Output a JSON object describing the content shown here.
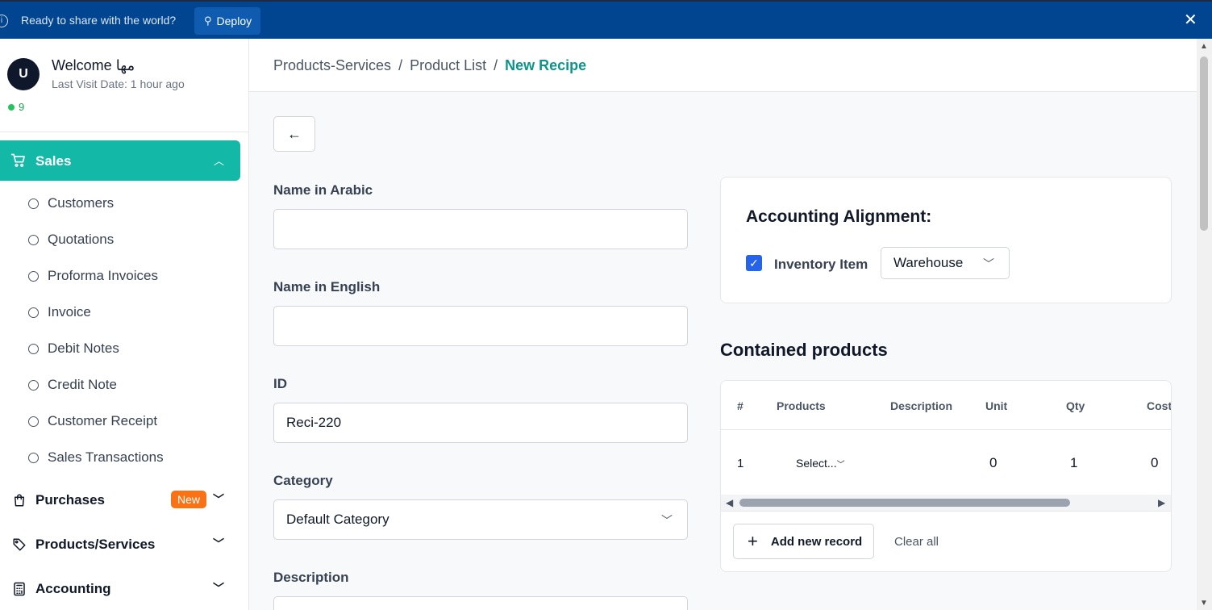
{
  "banner": {
    "message": "Ready to share with the world?",
    "deploy_label": "Deploy",
    "close_symbol": "✕"
  },
  "user": {
    "avatar_initial": "U",
    "welcome": "Welcome مها",
    "last_visit": "Last Visit Date: 1 hour ago",
    "status_count": "9"
  },
  "sidebar": {
    "sales_label": "Sales",
    "sales_items": [
      "Customers",
      "Quotations",
      "Proforma Invoices",
      "Invoice",
      "Debit Notes",
      "Credit Note",
      "Customer Receipt",
      "Sales Transactions"
    ],
    "purchases_label": "Purchases",
    "purchases_badge": "New",
    "products_label": "Products/Services",
    "accounting_label": "Accounting"
  },
  "breadcrumb": {
    "items": [
      "Products-Services",
      "Product List",
      "New Recipe"
    ],
    "separator": "/"
  },
  "form": {
    "name_arabic_label": "Name in Arabic",
    "name_arabic_value": "",
    "name_english_label": "Name in English",
    "name_english_value": "",
    "id_label": "ID",
    "id_value": "Reci-220",
    "category_label": "Category",
    "category_value": "Default Category",
    "description_label": "Description"
  },
  "accounting": {
    "title": "Accounting Alignment:",
    "inventory_label": "Inventory Item",
    "inventory_checked": true,
    "warehouse_value": "Warehouse"
  },
  "contained": {
    "title": "Contained products",
    "columns": [
      "#",
      "Products",
      "Description",
      "Unit",
      "Qty",
      "Cost"
    ],
    "rows": [
      {
        "index": "1",
        "product": "Select...",
        "description": "",
        "unit": "0",
        "qty": "1",
        "cost": "0"
      }
    ],
    "add_label": "Add new record",
    "clear_label": "Clear all"
  },
  "colors": {
    "banner_bg": "#014591",
    "accent": "#14b8a6",
    "breadcrumb_current": "#0d9488",
    "badge": "#f97316",
    "checkbox": "#2563eb"
  }
}
